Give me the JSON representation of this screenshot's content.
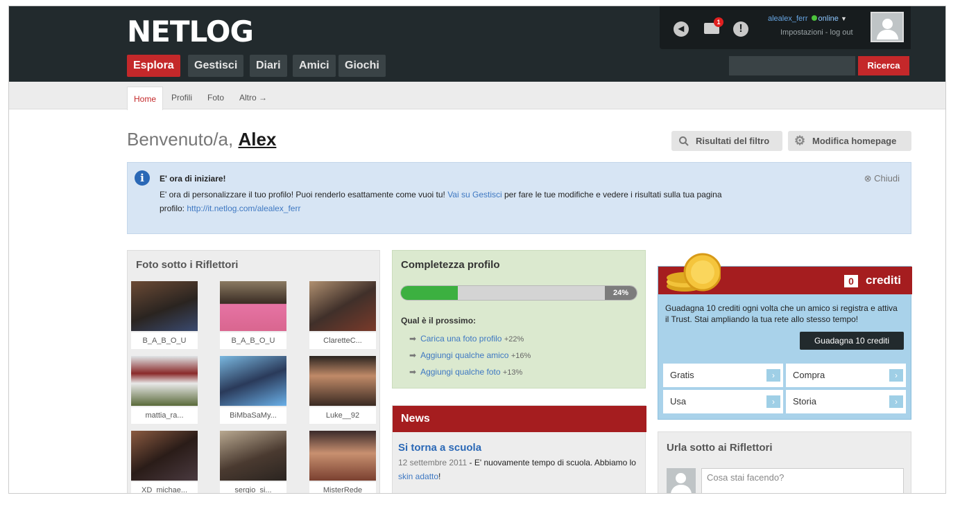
{
  "brand": {
    "logo": "NETLOG"
  },
  "nav": {
    "tabs": [
      "Esplora",
      "Gestisci",
      "Diari",
      "Amici",
      "Giochi"
    ],
    "active": "Esplora"
  },
  "user": {
    "username": "alealex_ferr",
    "status": "online",
    "links": "Impostazioni - log out",
    "mail_badge": "1"
  },
  "search": {
    "button": "Ricerca"
  },
  "subnav": {
    "tabs": [
      "Home",
      "Profili",
      "Foto",
      "Altro →"
    ]
  },
  "welcome": {
    "prefix": "Benvenuto/a,",
    "name": "Alex"
  },
  "actions": {
    "filter": "Risultati del filtro",
    "edit": "Modifica homepage"
  },
  "info": {
    "title": "E' ora di iniziare!",
    "text1": "E' ora di personalizzare il tuo profilo! Puoi renderlo esattamente come vuoi tu!",
    "link1": "Vai su Gestisci",
    "text2": "per fare le tue modifiche e vedere i risultati sulla tua pagina",
    "text3": "profilo:",
    "link2": "http://it.netlog.com/alealex_ferr",
    "close": "Chiudi"
  },
  "photos": {
    "title": "Foto sotto i Riflettori",
    "items": [
      "B_A_B_O_U",
      "B_A_B_O_U",
      "ClaretteC...",
      "mattia_ra...",
      "BiMbaSaMy...",
      "Luke__92",
      "XD_michae...",
      "sergio_si...",
      "MisterRede"
    ]
  },
  "completeness": {
    "title": "Completezza profilo",
    "percent": 24,
    "percent_label": "24%",
    "next_title": "Qual è il prossimo:",
    "items": [
      {
        "label": "Carica una foto profilo",
        "points": "+22%"
      },
      {
        "label": "Aggiungi qualche amico",
        "points": "+16%"
      },
      {
        "label": "Aggiungi qualche foto",
        "points": "+13%"
      }
    ]
  },
  "news": {
    "heading": "News",
    "title": "Si torna a scuola",
    "date": "12 settembre 2011",
    "text1": "- E' nuovamente tempo di scuola. Abbiamo lo",
    "link": "skin adatto",
    "text2": "!"
  },
  "credits": {
    "count": "0",
    "label": "crediti",
    "description": "Guadagna 10 crediti ogni volta che un amico si registra e attiva il Trust. Stai ampliando la tua rete allo stesso tempo!",
    "button": "Guadagna 10 crediti",
    "options": [
      "Gratis",
      "Compra",
      "Usa",
      "Storia"
    ]
  },
  "urla": {
    "title": "Urla sotto ai Riflettori",
    "placeholder": "Cosa stai facendo?"
  },
  "colors": {
    "header": "#222a2d",
    "accent": "#c4282a",
    "news": "#a51d1f",
    "info_bg": "#d7e5f4",
    "progress": "#3cb040",
    "credits_bg": "#a9d2ea"
  },
  "icons": [
    "back-icon",
    "mail-icon",
    "alert-icon",
    "avatar-icon",
    "search-icon",
    "gear-icon",
    "info-icon",
    "close-icon",
    "arrow-icon",
    "coins-icon",
    "chevron-right-icon"
  ]
}
